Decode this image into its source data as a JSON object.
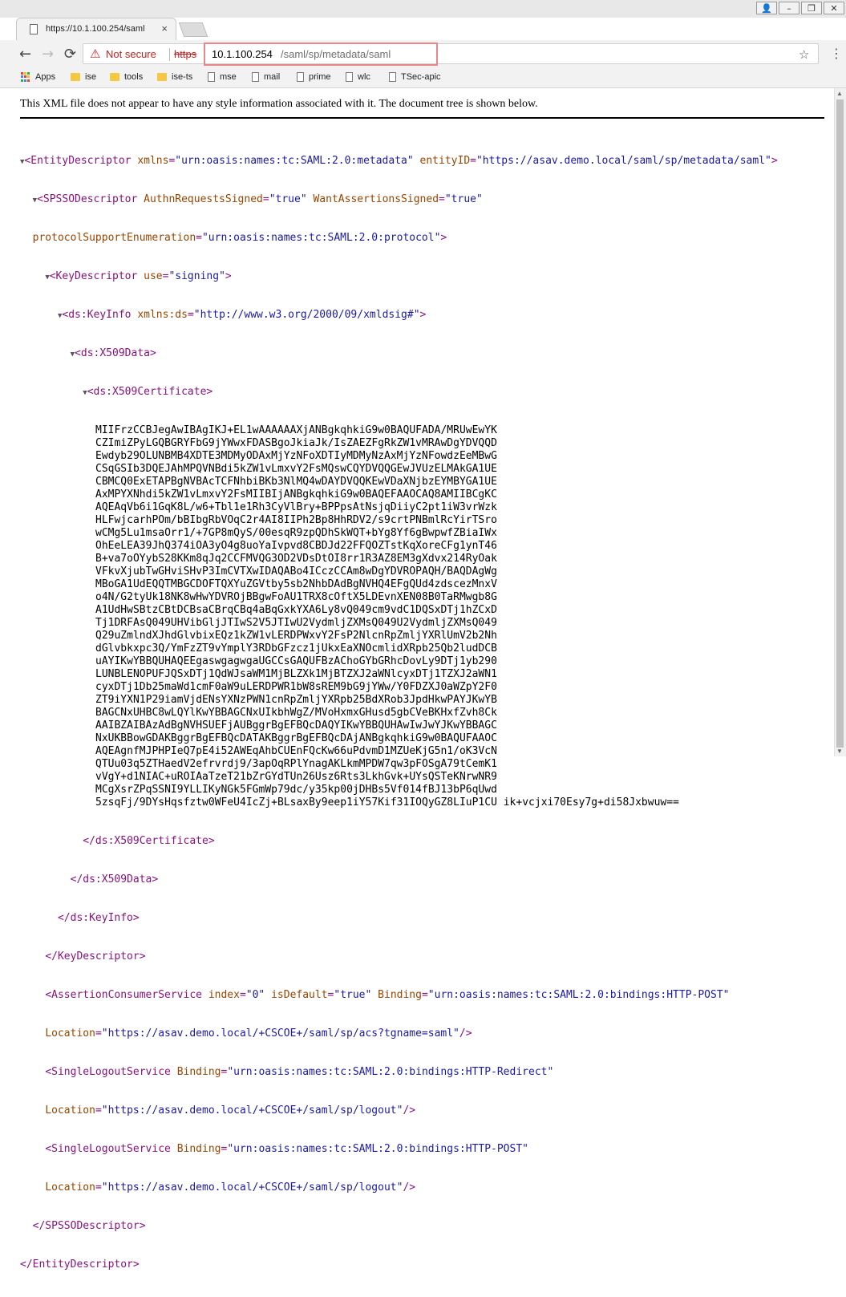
{
  "tab": {
    "title": "https://10.1.100.254/saml",
    "close": "×"
  },
  "window": {
    "user": "👤",
    "minimize": "–",
    "restore": "❐",
    "close": "✕"
  },
  "nav": {
    "back": "←",
    "forward": "→",
    "reload": "⟳"
  },
  "omnibox": {
    "warning": "⚠",
    "security": "Not secure",
    "scheme": "https",
    "host": "10.1.100.254",
    "path": "/saml/sp/metadata/saml",
    "star": "☆",
    "menu": "⋮"
  },
  "bookmarks": [
    {
      "label": "Apps",
      "icon": "apps"
    },
    {
      "label": "ise",
      "icon": "folder"
    },
    {
      "label": "tools",
      "icon": "folder"
    },
    {
      "label": "ise-ts",
      "icon": "folder"
    },
    {
      "label": "mse",
      "icon": "page"
    },
    {
      "label": "mail",
      "icon": "page"
    },
    {
      "label": "prime",
      "icon": "page"
    },
    {
      "label": "wlc",
      "icon": "page"
    },
    {
      "label": "TSec-apic",
      "icon": "page"
    }
  ],
  "colors": {
    "warning": "#c5221f",
    "highlight": "#e8868a",
    "tag": "#881280",
    "attr_name": "#994500",
    "attr_value": "#1a1aa6"
  },
  "notice": "This XML file does not appear to have any style information associated with it. The document tree is shown below.",
  "xml": {
    "ed_open": "<EntityDescriptor",
    "ed_xmlns_n": "xmlns",
    "ed_xmlns_v": "\"urn:oasis:names:tc:SAML:2.0:metadata\"",
    "ed_id_n": "entityID",
    "ed_id_v": "\"https://asav.demo.local/saml/sp/metadata/saml\"",
    "spsso_open": "<SPSSODescriptor",
    "spsso_a1_n": "AuthnRequestsSigned",
    "spsso_a1_v": "\"true\"",
    "spsso_a2_n": "WantAssertionsSigned",
    "spsso_a2_v": "\"true\"",
    "spsso_a3_n": "protocolSupportEnumeration",
    "spsso_a3_v": "\"urn:oasis:names:tc:SAML:2.0:protocol\"",
    "kd_open": "<KeyDescriptor",
    "kd_use_n": "use",
    "kd_use_v": "\"signing\"",
    "ki_open": "<ds:KeyInfo",
    "ki_xmlns_n": "xmlns:ds",
    "ki_xmlns_v": "\"http://www.w3.org/2000/09/xmldsig#\"",
    "x509data_open": "<ds:X509Data>",
    "x509cert_open": "<ds:X509Certificate>",
    "cert_lines": [
      "MIIFrzCCBJegAwIBAgIKJ+EL1wAAAAAAXjANBgkqhkiG9w0BAQUFADA/MRUwEwYK",
      "CZImiZPyLGQBGRYFbG9jYWwxFDASBgoJkiaJk/IsZAEZFgRkZW1vMRAwDgYDVQQD",
      "Ewdyb29OLUNBMB4XDTE3MDMyODAxMjYzNFoXDTIyMDMyNzAxMjYzNFowdzEeMBwG",
      "CSqGSIb3DQEJAhMPQVNBdi5kZW1vLmxvY2FsMQswCQYDVQQGEwJVUzELMAkGA1UE",
      "CBMCQ0ExETAPBgNVBAcTCFNhbiBKb3NlMQ4wDAYDVQQKEwVDaXNjbzEYMBYGA1UE",
      "AxMPYXNhdi5kZW1vLmxvY2FsMIIBIjANBgkqhkiG9w0BAQEFAAOCAQ8AMIIBCgKC",
      "AQEAqVb6i1GqK8L/w6+Tbl1e1Rh3CyVlBry+BPPpsAtNsjqDiiyC2pt1iW3vrWzk",
      "HLFwjcarhPOm/bBIbgRbVOqC2r4AI8IIPh2Bp8HhRDV2/s9crtPNBmlRcYirTSro",
      "wCMg5Lu1msaOrr1/+7GP8mQyS/00esqR9zpQDhSkWQT+bYg8Yf6gBwpwfZBiaIWx",
      "OhEeLEA39JhQ374iOA3yO4g8uoYaIvpvd8CBDJd22FFQOZTstKqXoreCFg1ynT46",
      "B+va7oOYybS28KKm8qJq2CCFMVQG3OD2VDsDtOI8rr1R3AZ8EM3gXdvx214RyOak",
      "VFkvXjubTwGHviSHvP3ImCVTXwIDAQABo4ICczCCAm8wDgYDVROPAQH/BAQDAgWg",
      "MBoGA1UdEQQTMBGCDOFTQXYuZGVtby5sb2NhbDAdBgNVHQ4EFgQUd4zdscezMnxV",
      "o4N/G2tyUk18NK8wHwYDVROjBBgwFoAU1TRX8cOftX5LDEvnXEN08B0TaRMwgb8G",
      "A1UdHwSBtzCBtDCBsaCBrqCBq4aBqGxkYXA6Ly8vQ049cm9vdC1DQSxDTj1hZCxD",
      "Tj1DRFAsQ049UHVibGljJTIwS2V5JTIwU2VydmljZXMsQ049U2VydmljZXMsQ049",
      "Q29uZmlndXJhdGlvbixEQz1kZW1vLERDPWxvY2FsP2NlcnRpZmljYXRlUmV2b2Nh",
      "dGlvbkxpc3Q/YmFzZT9vYmplY3RDbGFzcz1jUkxEaXNOcmlidXRpb25Qb2ludDCB",
      "uAYIKwYBBQUHAQEEgaswgagwgaUGCCsGAQUFBzAChoGYbGRhcDovLy9DTj1yb290",
      "LUNBLENOPUFJQSxDTj1QdWJsaWM1MjBLZXk1MjBTZXJ2aWNlcyxDTj1TZXJ2aWN1",
      "cyxDTj1Db25maWd1cmF0aW9uLERDPWR1bW8sREM9bG9jYWw/Y0FDZXJ0aWZpY2F0",
      "ZT9iYXN1P29iamVjdENsYXNzPWN1cnRpZmljYXRpb25BdXRob3JpdHkwPAYJKwYB",
      "BAGCNxUHBC8wLQYlKwYBBAGCNxUIkbhWgZ/MVoHxmxGHusd5gbCVeBKHxfZvh8Ck",
      "AAIBZAIBAzAdBgNVHSUEFjAUBggrBgEFBQcDAQYIKwYBBQUHAwIwJwYJKwYBBAGC",
      "NxUKBBowGDAKBggrBgEFBQcDATAKBggrBgEFBQcDAjANBgkqhkiG9w0BAQUFAAOC",
      "AQEAgnfMJPHPIeQ7pE4i52AWEqAhbCUEnFQcKw66uPdvmD1MZUeKjG5n1/oK3VcN",
      "QTUu03q5ZTHaedV2efrvrdj9/3apOqRPlYnagAKLkmMPDW7qw3pFOSgA79tCemK1",
      "vVgY+d1NIAC+uROIAaTzeT21bZrGYdTUn26Usz6Rts3LkhGvk+UYsQSTeKNrwNR9",
      "MCgXsrZPqSSNI9YLLIKyNGk5FGmWp79dc/y35kp00jDHBs5Vf014fBJ13bP6qUwd",
      "5zsqFj/9DYsHqsfztw0WFeU4IcZj+BLsaxBy9eep1iY57Kif31IOQyGZ8LIuP1CU ik+vcjxi70Esy7g+di58Jxbwuw=="
    ],
    "x509cert_close": "</ds:X509Certificate>",
    "x509data_close": "</ds:X509Data>",
    "ki_close": "</ds:KeyInfo>",
    "kd_close": "</KeyDescriptor>",
    "acs_open": "<AssertionConsumerService",
    "acs_index_n": "index",
    "acs_index_v": "\"0\"",
    "acs_default_n": "isDefault",
    "acs_default_v": "\"true\"",
    "acs_binding_n": "Binding",
    "acs_binding_v": "\"urn:oasis:names:tc:SAML:2.0:bindings:HTTP-POST\"",
    "acs_loc_n": "Location",
    "acs_loc_v": "\"https://asav.demo.local/+CSCOE+/saml/sp/acs?tgname=saml\"",
    "slo1_open": "<SingleLogoutService",
    "slo1_binding_n": "Binding",
    "slo1_binding_v": "\"urn:oasis:names:tc:SAML:2.0:bindings:HTTP-Redirect\"",
    "slo1_loc_n": "Location",
    "slo1_loc_v": "\"https://asav.demo.local/+CSCOE+/saml/sp/logout\"",
    "slo2_open": "<SingleLogoutService",
    "slo2_binding_n": "Binding",
    "slo2_binding_v": "\"urn:oasis:names:tc:SAML:2.0:bindings:HTTP-POST\"",
    "slo2_loc_n": "Location",
    "slo2_loc_v": "\"https://asav.demo.local/+CSCOE+/saml/sp/logout\"",
    "spsso_close": "</SPSSODescriptor>",
    "ed_close": "</EntityDescriptor>"
  }
}
